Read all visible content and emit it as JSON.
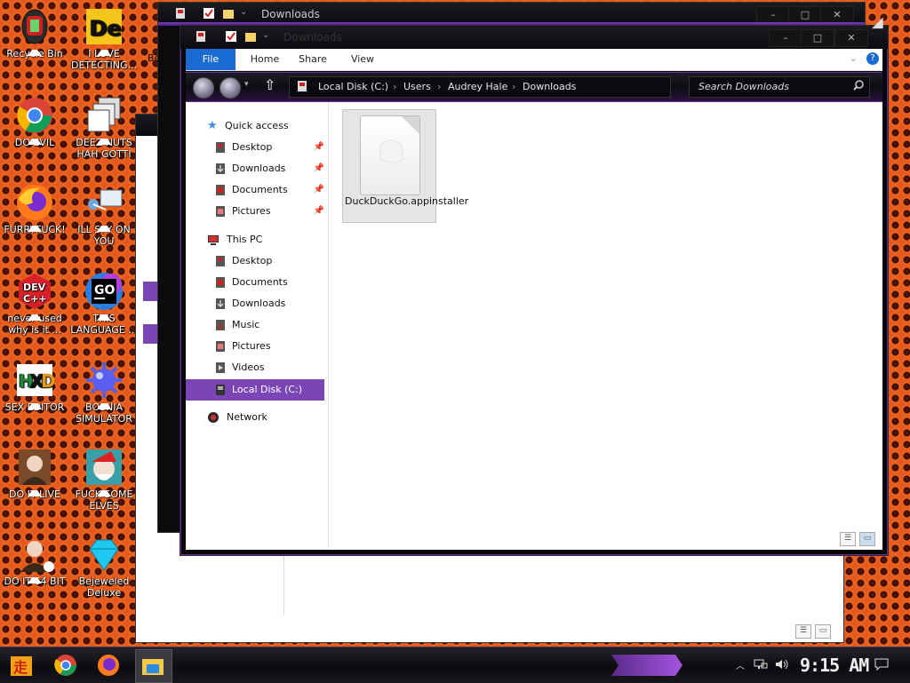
{
  "desktop_icons": [
    {
      "label": "Recycle Bin",
      "icon": "recycle-bin-icon"
    },
    {
      "label": "I LOVE DETECTING...",
      "icon": "detect-it-easy-icon"
    },
    {
      "label": "DO EVIL",
      "icon": "chrome-icon"
    },
    {
      "label": "DEEZ NUTS HAH GOTTI",
      "icon": "windows-stack-icon"
    },
    {
      "label": "FURRYFUCK!",
      "icon": "firefox-icon"
    },
    {
      "label": "ILL SPY ON YOU",
      "icon": "network-camera-icon"
    },
    {
      "label": "never used why is it ...",
      "icon": "dev-cpp-icon"
    },
    {
      "label": "THIS LANGUAGE ...",
      "icon": "goland-icon"
    },
    {
      "label": "SEX EDITOR",
      "icon": "hxd-icon"
    },
    {
      "label": "BOSNIA SIMULATOR",
      "icon": "mine-icon"
    },
    {
      "label": "DO IT LIVE",
      "icon": "portrait-icon"
    },
    {
      "label": "FUCK SOME ELVES",
      "icon": "santa-icon"
    },
    {
      "label": "DO IT 64 BIT",
      "icon": "portrait-64-icon"
    },
    {
      "label": "Bejeweled Deluxe",
      "icon": "diamond-icon"
    }
  ],
  "back_window": {
    "title": "Downloads",
    "partial_text": "Be"
  },
  "window": {
    "title": "Downloads",
    "ribbon": {
      "file": "File",
      "home": "Home",
      "share": "Share",
      "view": "View"
    },
    "breadcrumb": [
      "Local Disk (C:)",
      "Users",
      "Audrey Hale",
      "Downloads"
    ],
    "search_placeholder": "Search Downloads",
    "nav": {
      "quick_access": "Quick access",
      "quick_items": [
        "Desktop",
        "Downloads",
        "Documents",
        "Pictures"
      ],
      "this_pc": "This PC",
      "pc_items": [
        "Desktop",
        "Documents",
        "Downloads",
        "Music",
        "Pictures",
        "Videos"
      ],
      "local_disk": "Local Disk (C:)",
      "network": "Network"
    },
    "files": [
      {
        "name": "DuckDuckGo.appinstaller"
      }
    ]
  },
  "taskbar": {
    "clock": "9:15 AM"
  },
  "colors": {
    "accent_purple": "#7b45b8",
    "ribbon_file_blue": "#1a6cd2",
    "desktop_orange": "#e4581c"
  }
}
